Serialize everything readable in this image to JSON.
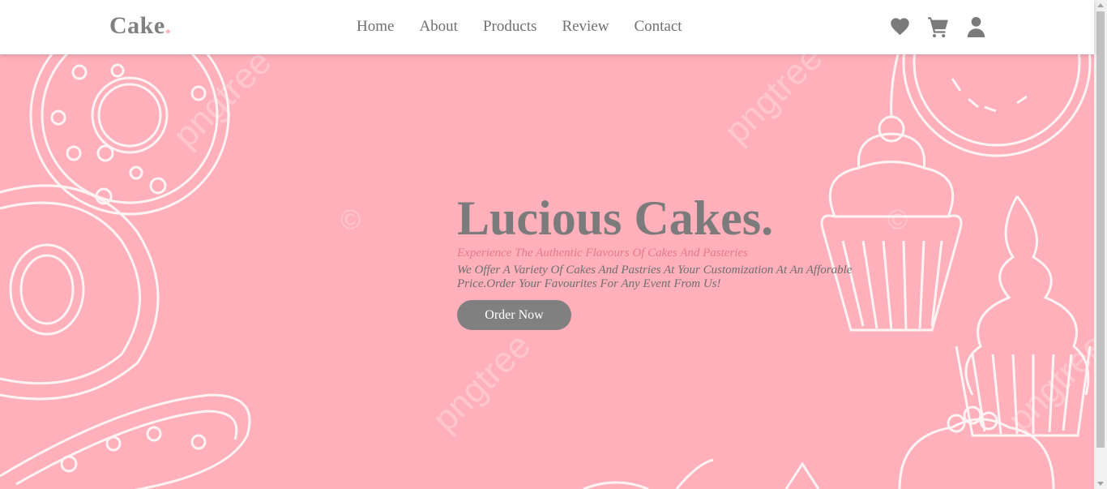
{
  "header": {
    "logo_text": "Cake",
    "logo_dot": ".",
    "nav": [
      "Home",
      "About",
      "Products",
      "Review",
      "Contact"
    ],
    "icons": [
      "heart-icon",
      "cart-icon",
      "user-icon"
    ]
  },
  "hero": {
    "title": "Lucious Cakes.",
    "tagline": "Experience The Authentic Flavours Of Cakes And Pasteries",
    "description": "We Offer A Variety Of Cakes And Pastries At Your Customization At An Afforable Price.Order Your Favourites For Any Event From Us!",
    "button_label": "Order Now",
    "watermark": "pngtree"
  },
  "colors": {
    "hero_bg": "#ffb0bb",
    "text_gray": "#7b7b7b",
    "accent_pink": "#e8798a",
    "button_bg": "#808080"
  }
}
